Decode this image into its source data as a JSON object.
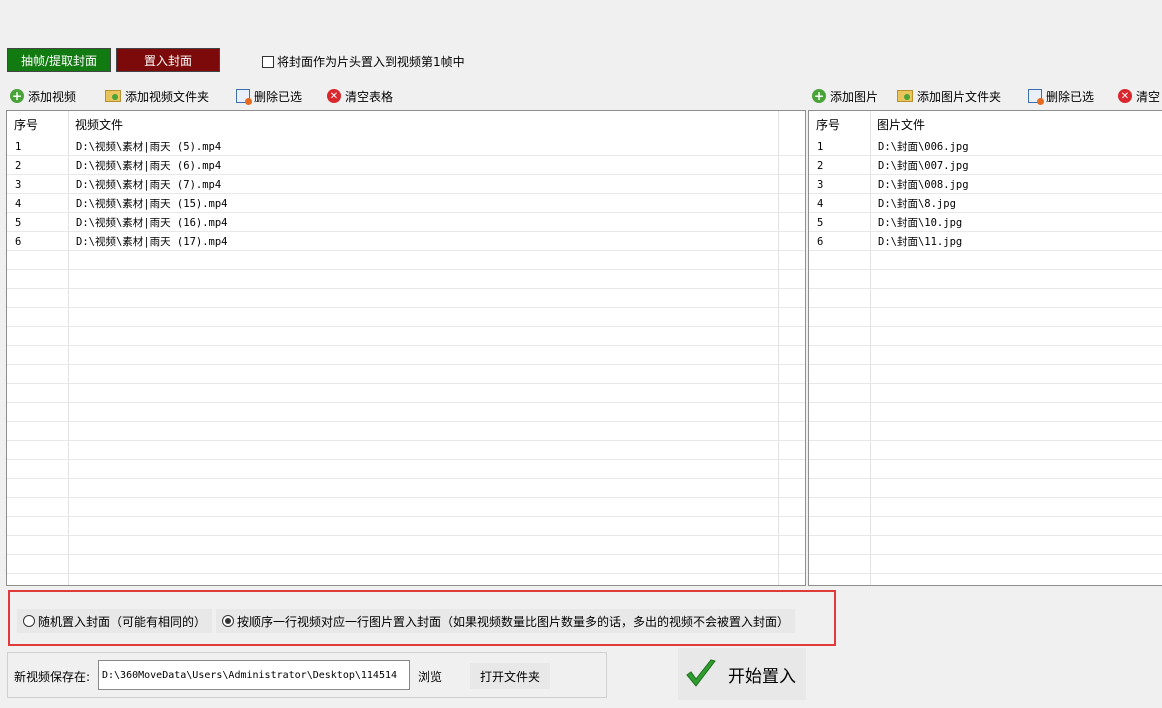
{
  "mode_buttons": {
    "extract": "抽帧/提取封面",
    "embed": "置入封面"
  },
  "intro_checkbox": {
    "label": "将封面作为片头置入到视频第1帧中",
    "checked": false
  },
  "video_toolbar": {
    "add": "添加视频",
    "add_folder": "添加视频文件夹",
    "delete": "删除已选",
    "clear": "清空表格"
  },
  "image_toolbar": {
    "add": "添加图片",
    "add_folder": "添加图片文件夹",
    "delete": "删除已选",
    "clear": "清空"
  },
  "video_table": {
    "columns": [
      "序号",
      "视频文件"
    ],
    "rows": [
      [
        "1",
        "D:\\视频\\素材|雨天 (5).mp4"
      ],
      [
        "2",
        "D:\\视频\\素材|雨天 (6).mp4"
      ],
      [
        "3",
        "D:\\视频\\素材|雨天 (7).mp4"
      ],
      [
        "4",
        "D:\\视频\\素材|雨天 (15).mp4"
      ],
      [
        "5",
        "D:\\视频\\素材|雨天 (16).mp4"
      ],
      [
        "6",
        "D:\\视频\\素材|雨天 (17).mp4"
      ]
    ]
  },
  "image_table": {
    "columns": [
      "序号",
      "图片文件"
    ],
    "rows": [
      [
        "1",
        "D:\\封面\\006.jpg"
      ],
      [
        "2",
        "D:\\封面\\007.jpg"
      ],
      [
        "3",
        "D:\\封面\\008.jpg"
      ],
      [
        "4",
        "D:\\封面\\8.jpg"
      ],
      [
        "5",
        "D:\\封面\\10.jpg"
      ],
      [
        "6",
        "D:\\封面\\11.jpg"
      ]
    ]
  },
  "options": {
    "random": "随机置入封面（可能有相同的）",
    "sequential": "按顺序一行视频对应一行图片置入封面（如果视频数量比图片数量多的话，多出的视频不会被置入封面）",
    "selected": "sequential"
  },
  "save": {
    "label": "新视频保存在:",
    "path": "D:\\360MoveData\\Users\\Administrator\\Desktop\\114514",
    "browse": "浏览",
    "open_folder": "打开文件夹"
  },
  "start_button": "开始置入",
  "colors": {
    "extract_bg": "#117a11",
    "embed_bg": "#7c0a0a",
    "highlight_border": "#e03a3a",
    "check_green": "#2e9e2e"
  }
}
